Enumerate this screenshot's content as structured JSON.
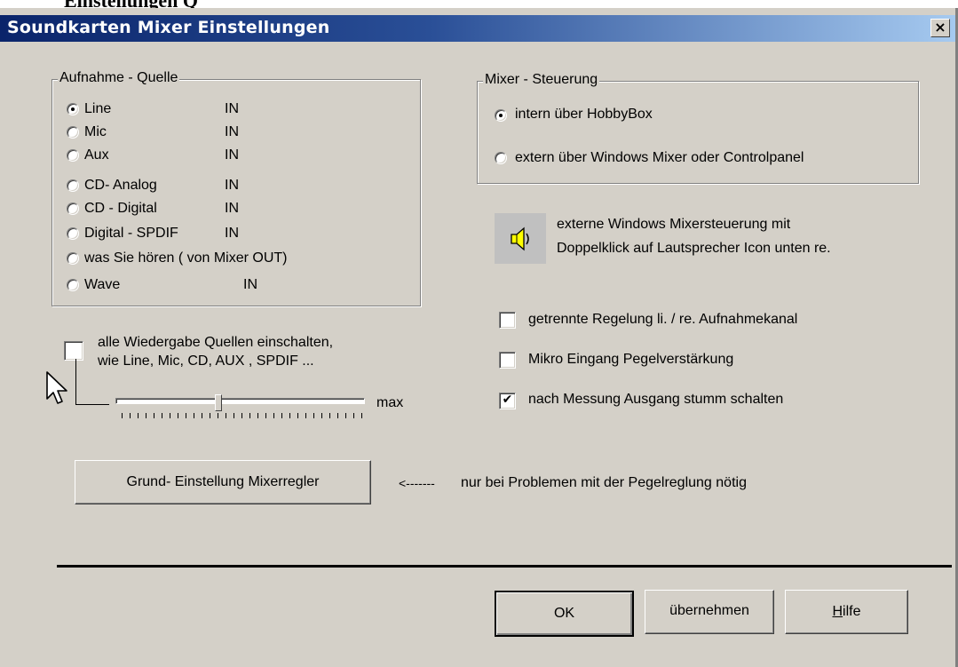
{
  "background_title": "Einstellungen Q",
  "window": {
    "title": "Soundkarten Mixer  Einstellungen",
    "close_label": "×"
  },
  "recording_source": {
    "label": "Aufnahme - Quelle",
    "items": [
      {
        "name": "Line",
        "suffix": "IN",
        "checked": true
      },
      {
        "name": "Mic",
        "suffix": "IN",
        "checked": false
      },
      {
        "name": "Aux",
        "suffix": "IN",
        "checked": false
      },
      {
        "name": "CD- Analog",
        "suffix": "IN",
        "checked": false
      },
      {
        "name": "CD - Digital",
        "suffix": "IN",
        "checked": false
      },
      {
        "name": "Digital - SPDIF",
        "suffix": "IN",
        "checked": false
      },
      {
        "name": "was Sie hören ( von Mixer OUT)",
        "suffix": "",
        "checked": false
      },
      {
        "name": "Wave",
        "suffix": "IN",
        "checked": false
      }
    ]
  },
  "mixer_control": {
    "label": "Mixer - Steuerung",
    "items": [
      {
        "label": "intern über HobbyBox",
        "checked": true
      },
      {
        "label": "extern über Windows Mixer oder Controlpanel",
        "checked": false
      }
    ]
  },
  "speaker_info": {
    "line1": "externe Windows Mixersteuerung mit",
    "line2": "Doppelklick auf Lautsprecher Icon unten re.",
    "icon": "speaker-icon"
  },
  "playback": {
    "checkbox_line1": "alle Wiedergabe Quellen einschalten,",
    "checkbox_line2": "wie Line, Mic, CD,  AUX , SPDIF ...",
    "checked": false,
    "slider_max_label": "max",
    "slider_level": 0.41
  },
  "options": [
    {
      "label": "getrennte Regelung  li. / re. Aufnahmekanal",
      "checked": false
    },
    {
      "label": "Mikro Eingang Pegelverstärkung",
      "checked": false
    },
    {
      "label": "nach Messung  Ausgang stumm schalten",
      "checked": true
    }
  ],
  "reset": {
    "button_label": "Grund- Einstellung Mixerregler",
    "arrow": "<-------",
    "hint": "nur bei Problemen mit der  Pegelreglung  nötig"
  },
  "footer": {
    "ok_label": "OK",
    "apply_label": "übernehmen",
    "help_label": "Hilfe",
    "help_accelerator": "H"
  },
  "colors": {
    "dialog_face": "#d4d0c8",
    "title_gradient_start": "#0a246a",
    "title_gradient_end": "#a6caf0",
    "speaker_box": "#c0c0c0",
    "speaker_icon": "#ffff00"
  }
}
